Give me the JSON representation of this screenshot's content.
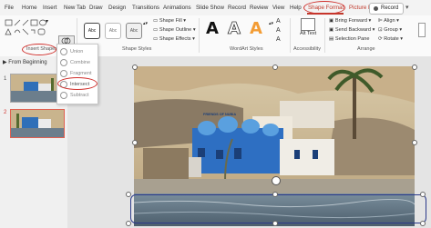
{
  "tabs": [
    "File",
    "Home",
    "Insert",
    "New Tab",
    "Draw",
    "Design",
    "Transitions",
    "Animations",
    "Slide Show",
    "Record",
    "Review",
    "View",
    "Help",
    "Shape Format",
    "Picture Format"
  ],
  "record_label": "Record",
  "ribbon": {
    "shape_fill": "Shape Fill",
    "shape_outline": "Shape Outline",
    "shape_effects": "Shape Effects",
    "style_sample": "Abc",
    "wordart_letter": "A",
    "alt_text": "Alt Text",
    "bring_forward": "Bring Forward",
    "send_backward": "Send Backward",
    "selection_pane": "Selection Pane",
    "align": "Align",
    "group": "Group",
    "rotate": "Rotate",
    "groups": {
      "insert_shapes": "Insert Shapes",
      "shape_styles": "Shape Styles",
      "wordart_styles": "WordArt Styles",
      "accessibility": "Accessibility",
      "arrange": "Arrange"
    }
  },
  "left_panel": {
    "from_beginning": "From Beginning",
    "slides": [
      "1",
      "2"
    ]
  },
  "merge_menu": {
    "items": [
      "Union",
      "Combine",
      "Fragment",
      "Intersect",
      "Subtract"
    ],
    "highlighted": "Intersect"
  },
  "photo_sign": "FRIENDS OF NUBIA",
  "colors": {
    "accent": "#c0392b",
    "annotation": "#d0312d",
    "selection_outline": "#2b3a8a"
  }
}
